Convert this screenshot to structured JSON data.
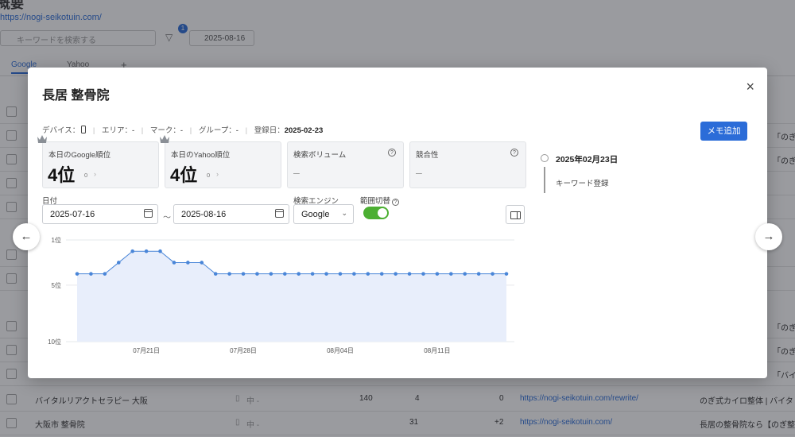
{
  "background": {
    "title": "概要",
    "url": "https://nogi-seikotuin.com/",
    "search_placeholder": "キーワードを検索する",
    "filter_badge": "1",
    "date": "2025-08-16",
    "tabs": [
      {
        "label": "Google"
      },
      {
        "label": "Yahoo"
      }
    ],
    "add_tab": "+",
    "rows": [
      {
        "keyword": "バイタルリアクトセラピー 大阪",
        "device": "▯",
        "area": "中 -",
        "volume": "140",
        "rank": "4",
        "change": "0",
        "url": "https://nogi-seikotuin.com/rewrite/",
        "title": "のぎ式カイロ整体 | バイタ"
      },
      {
        "keyword": "大阪市 整骨院",
        "device": "▯",
        "area": "中 -",
        "volume": "",
        "rank": "31",
        "change": "+2",
        "url": "https://nogi-seikotuin.com/",
        "title": "長居の整骨院なら【のぎ整"
      }
    ],
    "side_texts": [
      "「のぎ",
      "「のぎ",
      "「のぎ",
      "「のぎ",
      "「バイ",
      "「のぎ"
    ]
  },
  "modal": {
    "title": "長居 整骨院",
    "close_icon": "×",
    "meta": {
      "device_label": "デバイス：",
      "area_label": "エリア：",
      "area_value": "-",
      "mark_label": "マーク：",
      "mark_value": "-",
      "group_label": "グループ：",
      "group_value": "-",
      "registered_label": "登録日：",
      "registered_value": "2025-02-23"
    },
    "memo_button": "メモ追加",
    "cards": {
      "google": {
        "label": "本日のGoogle順位",
        "value": "4位",
        "sub": "0",
        "arrow": "›"
      },
      "yahoo": {
        "label": "本日のYahoo順位",
        "value": "4位",
        "sub": "0",
        "arrow": "›"
      },
      "volume": {
        "label": "検索ボリューム",
        "value": "–"
      },
      "competition": {
        "label": "競合性",
        "value": "–"
      }
    },
    "filters": {
      "date_label": "日付",
      "date_from": "2025-07-16",
      "date_to": "2025-08-16",
      "range_sep": "～",
      "engine_label": "検索エンジン",
      "engine_value": "Google",
      "toggle_label": "範囲切替",
      "toggle_on": true
    },
    "timeline": {
      "date": "2025年02月23日",
      "text": "キーワード登録"
    }
  },
  "chart_data": {
    "type": "area",
    "title": "",
    "xlabel": "",
    "ylabel": "",
    "y_inverted": true,
    "ylim": [
      1,
      10
    ],
    "yticks": [
      {
        "value": 1,
        "label": "1位"
      },
      {
        "value": 5,
        "label": "5位"
      },
      {
        "value": 10,
        "label": "10位"
      }
    ],
    "xticks": [
      {
        "date": "2025-07-21",
        "label": "07月21日"
      },
      {
        "date": "2025-07-28",
        "label": "07月28日"
      },
      {
        "date": "2025-08-04",
        "label": "08月04日"
      },
      {
        "date": "2025-08-11",
        "label": "08月11日"
      }
    ],
    "x": [
      "2025-07-16",
      "2025-07-17",
      "2025-07-18",
      "2025-07-19",
      "2025-07-20",
      "2025-07-21",
      "2025-07-22",
      "2025-07-23",
      "2025-07-24",
      "2025-07-25",
      "2025-07-26",
      "2025-07-27",
      "2025-07-28",
      "2025-07-29",
      "2025-07-30",
      "2025-07-31",
      "2025-08-01",
      "2025-08-02",
      "2025-08-03",
      "2025-08-04",
      "2025-08-05",
      "2025-08-06",
      "2025-08-07",
      "2025-08-08",
      "2025-08-09",
      "2025-08-10",
      "2025-08-11",
      "2025-08-12",
      "2025-08-13",
      "2025-08-14",
      "2025-08-15",
      "2025-08-16"
    ],
    "values": [
      4,
      4,
      4,
      3,
      2,
      2,
      2,
      3,
      3,
      3,
      4,
      4,
      4,
      4,
      4,
      4,
      4,
      4,
      4,
      4,
      4,
      4,
      4,
      4,
      4,
      4,
      4,
      4,
      4,
      4,
      4,
      4
    ],
    "colors": {
      "line": "#4a86d8",
      "fill": "#e8eefb",
      "grid": "#e6e8eb"
    }
  },
  "icons": {
    "prev": "←",
    "next": "→"
  }
}
